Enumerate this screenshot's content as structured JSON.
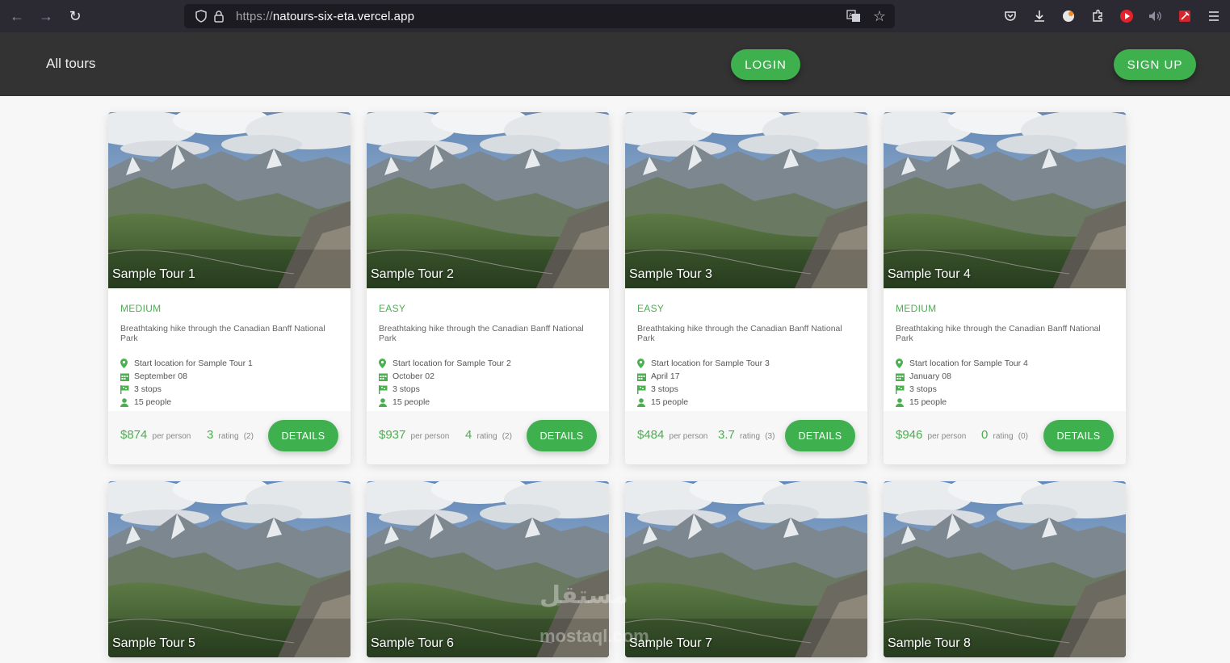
{
  "browser": {
    "url_scheme": "https://",
    "url_host": "natours-six-eta.vercel.app"
  },
  "header": {
    "nav_label": "All tours",
    "login_label": "LOGIN",
    "signup_label": "SIGN UP"
  },
  "labels": {
    "per_person": "per person",
    "rating": "rating",
    "details": "DETAILS"
  },
  "tours": [
    {
      "name": "Sample Tour 1",
      "difficulty": "MEDIUM",
      "summary": "Breathtaking hike through the Canadian Banff National Park",
      "location": "Start location for Sample Tour 1",
      "date": "September 08",
      "stops": "3 stops",
      "people": "15 people",
      "price": "$874",
      "rating": "3",
      "rating_count": "(2)"
    },
    {
      "name": "Sample Tour 2",
      "difficulty": "EASY",
      "summary": "Breathtaking hike through the Canadian Banff National Park",
      "location": "Start location for Sample Tour 2",
      "date": "October 02",
      "stops": "3 stops",
      "people": "15 people",
      "price": "$937",
      "rating": "4",
      "rating_count": "(2)"
    },
    {
      "name": "Sample Tour 3",
      "difficulty": "EASY",
      "summary": "Breathtaking hike through the Canadian Banff National Park",
      "location": "Start location for Sample Tour 3",
      "date": "April 17",
      "stops": "3 stops",
      "people": "15 people",
      "price": "$484",
      "rating": "3.7",
      "rating_count": "(3)"
    },
    {
      "name": "Sample Tour 4",
      "difficulty": "MEDIUM",
      "summary": "Breathtaking hike through the Canadian Banff National Park",
      "location": "Start location for Sample Tour 4",
      "date": "January 08",
      "stops": "3 stops",
      "people": "15 people",
      "price": "$946",
      "rating": "0",
      "rating_count": "(0)"
    },
    {
      "name": "Sample Tour 5"
    },
    {
      "name": "Sample Tour 6"
    },
    {
      "name": "Sample Tour 7"
    },
    {
      "name": "Sample Tour 8"
    }
  ],
  "watermark": {
    "line1": "مستقل",
    "line2": "mostaql.com"
  },
  "colors": {
    "accent": "#3fb04e",
    "header_bg": "#333333",
    "browser_bg": "#2b2a33"
  }
}
